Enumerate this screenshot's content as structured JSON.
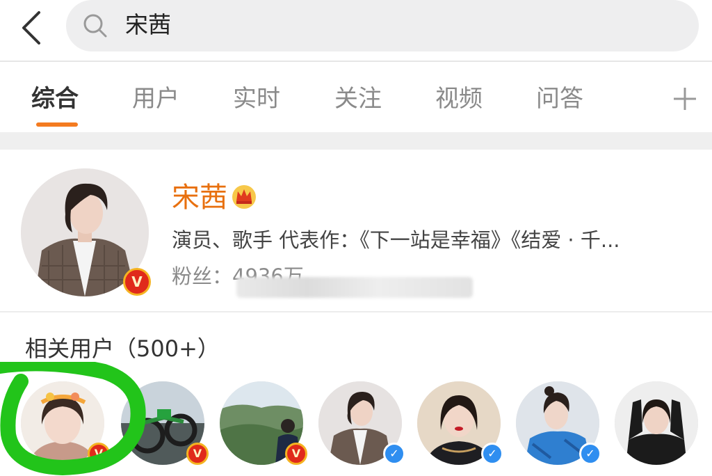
{
  "search": {
    "query": "宋茜"
  },
  "tabs": [
    {
      "label": "综合",
      "active": true
    },
    {
      "label": "用户",
      "active": false
    },
    {
      "label": "实时",
      "active": false
    },
    {
      "label": "关注",
      "active": false
    },
    {
      "label": "视频",
      "active": false
    },
    {
      "label": "问答",
      "active": false
    }
  ],
  "colors": {
    "accent": "#f47b20",
    "name_orange": "#e8700f",
    "verified_gold": "#f5b321",
    "verified_red": "#e02a1b",
    "verified_blue": "#2f8ef0",
    "annotation_green": "#22c41a"
  },
  "user_card": {
    "name": "宋茜",
    "description": "演员、歌手 代表作：《下一站是幸福》《结爱 · 千...",
    "fans": "粉丝：4936万",
    "badge": "crown-icon",
    "verified": "gold"
  },
  "related": {
    "title": "相关用户（500+）",
    "users": [
      {
        "verified": "gold",
        "icon": "avatar-girl-headband"
      },
      {
        "verified": "gold",
        "icon": "avatar-bikes"
      },
      {
        "verified": "gold",
        "icon": "avatar-mountain-hiker"
      },
      {
        "verified": "blue",
        "icon": "avatar-song-qian"
      },
      {
        "verified": "blue",
        "icon": "avatar-woman-red-lips"
      },
      {
        "verified": "blue",
        "icon": "avatar-woman-blue-jacket"
      },
      {
        "verified": "blue",
        "icon": "avatar-woman-hands-up"
      }
    ]
  }
}
